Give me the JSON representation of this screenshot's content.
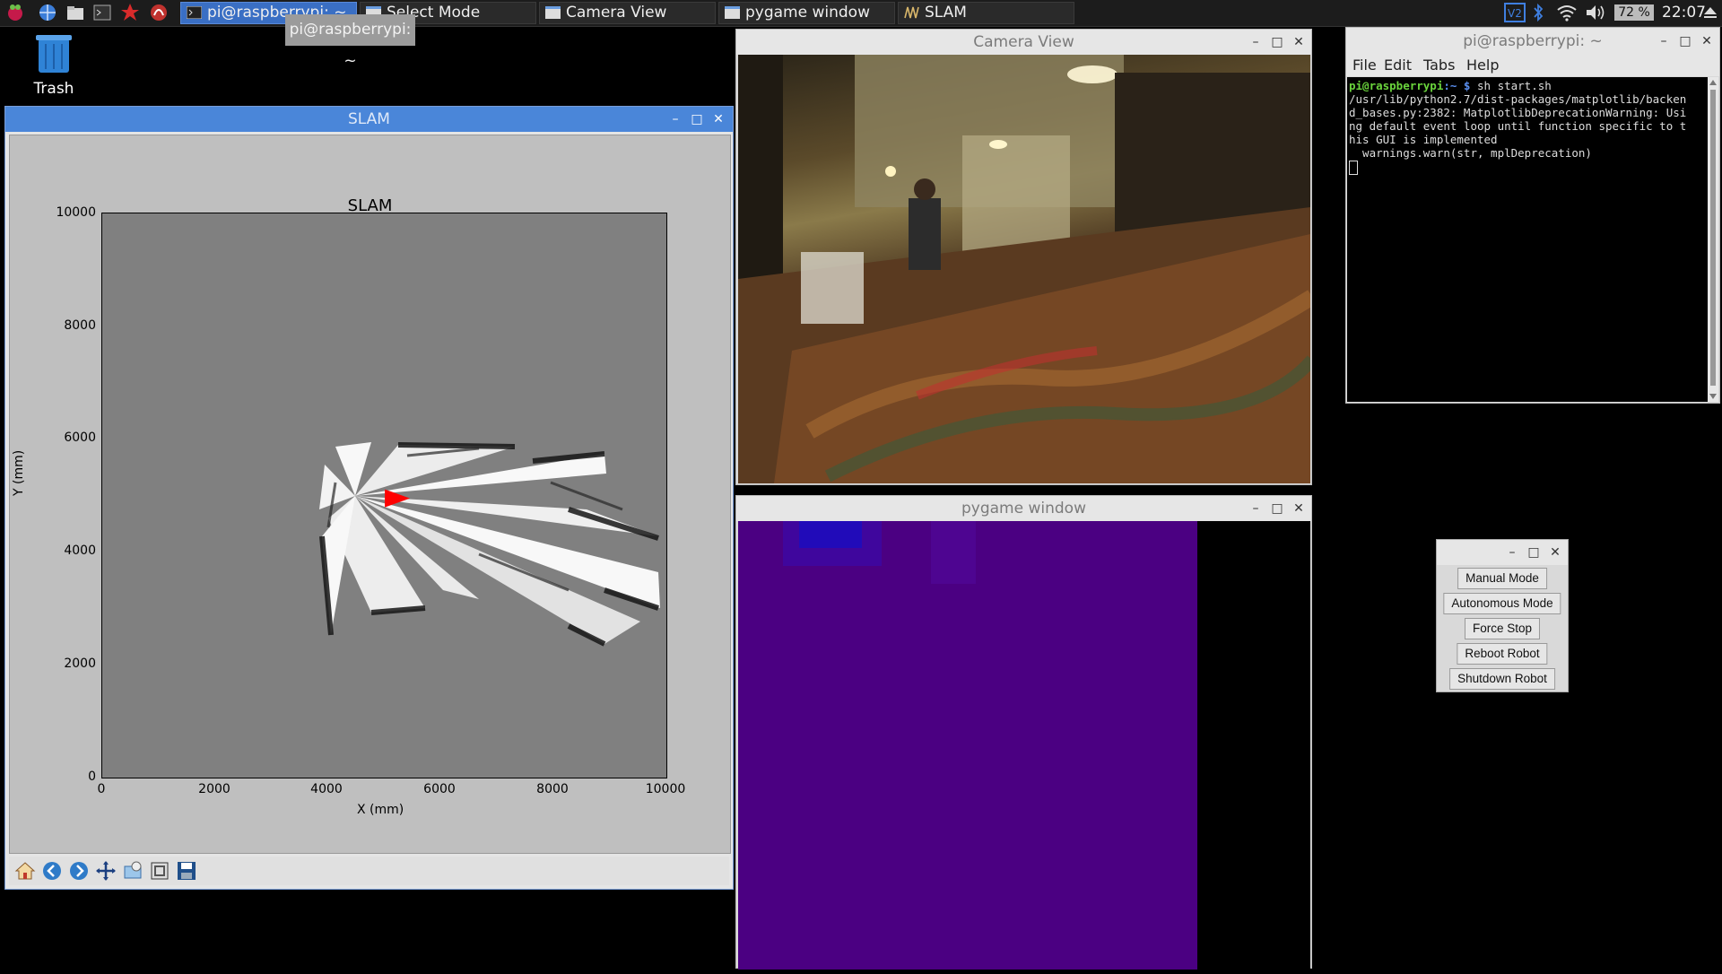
{
  "taskbar": {
    "tasks": [
      {
        "label": "pi@raspberrypi: ~",
        "icon": "terminal-icon"
      },
      {
        "label": "Select Mode",
        "icon": "window-icon"
      },
      {
        "label": "Camera View",
        "icon": "window-icon"
      },
      {
        "label": "pygame window",
        "icon": "window-icon"
      },
      {
        "label": "SLAM",
        "icon": "matplotlib-icon"
      }
    ],
    "battery": "72 %",
    "clock": "22:07",
    "tooltip": "pi@raspberrypi: ~"
  },
  "desktop": {
    "trash_label": "Trash"
  },
  "slam": {
    "window_title": "SLAM",
    "chart_data": {
      "type": "heatmap",
      "title": "SLAM",
      "xlabel": "X (mm)",
      "ylabel": "Y (mm)",
      "xlim": [
        0,
        10000
      ],
      "ylim": [
        0,
        10000
      ],
      "xticks": [
        "0",
        "2000",
        "4000",
        "6000",
        "8000",
        "10000"
      ],
      "yticks": [
        "0",
        "2000",
        "4000",
        "6000",
        "8000",
        "10000"
      ],
      "robot_position": {
        "x": 5200,
        "y": 4950,
        "heading": "east",
        "color": "#ff0000"
      },
      "grid": false
    },
    "toolbar": [
      "home-icon",
      "back-icon",
      "forward-icon",
      "pan-icon",
      "zoom-icon",
      "configure-icon",
      "save-icon"
    ]
  },
  "camera": {
    "window_title": "Camera View"
  },
  "pygame": {
    "window_title": "pygame window",
    "surface_color": "#4b0082"
  },
  "terminal": {
    "window_title": "pi@raspberrypi: ~",
    "menu": [
      "File",
      "Edit",
      "Tabs",
      "Help"
    ],
    "prompt_user": "pi@raspberrypi",
    "prompt_path": ":~ $",
    "command": " sh start.sh",
    "output": "/usr/lib/python2.7/dist-packages/matplotlib/backen\nd_bases.py:2382: MatplotlibDeprecationWarning: Usi\nng default event loop until function specific to t\nhis GUI is implemented\n  warnings.warn(str, mplDeprecation)"
  },
  "control": {
    "buttons": [
      "Manual Mode",
      "Autonomous Mode",
      "Force Stop",
      "Reboot Robot",
      "Shutdown Robot"
    ]
  }
}
